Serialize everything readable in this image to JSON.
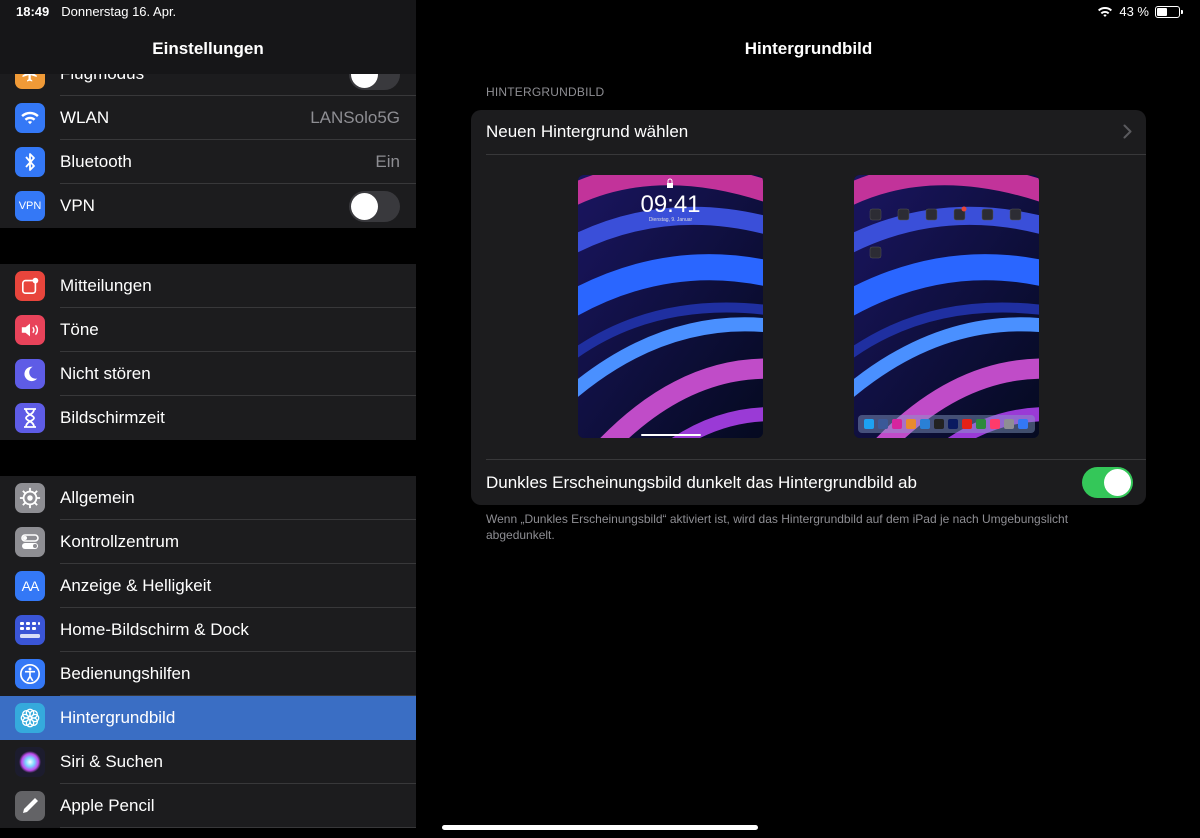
{
  "status": {
    "time": "18:49",
    "date": "Donnerstag 16. Apr.",
    "battery": "43 %",
    "battery_level": 0.43
  },
  "sidebar": {
    "title": "Einstellungen",
    "group1": [
      {
        "label": "Flugmodus",
        "icon": "airplane-icon",
        "color": "#f09a37",
        "toggle": false
      },
      {
        "label": "WLAN",
        "icon": "wifi-icon",
        "color": "#3478f6",
        "value": "LANSolo5G"
      },
      {
        "label": "Bluetooth",
        "icon": "bluetooth-icon",
        "color": "#3478f6",
        "value": "Ein"
      },
      {
        "label": "VPN",
        "icon": "vpn-icon",
        "color": "#3478f6",
        "toggle": false
      }
    ],
    "group2": [
      {
        "label": "Mitteilungen",
        "icon": "notifications-icon",
        "color": "#e8453c"
      },
      {
        "label": "Töne",
        "icon": "sounds-icon",
        "color": "#e8435a"
      },
      {
        "label": "Nicht stören",
        "icon": "moon-icon",
        "color": "#5e5ce6"
      },
      {
        "label": "Bildschirmzeit",
        "icon": "hourglass-icon",
        "color": "#5e5ce6"
      }
    ],
    "group3": [
      {
        "label": "Allgemein",
        "icon": "gear-icon",
        "color": "#8e8e93"
      },
      {
        "label": "Kontrollzentrum",
        "icon": "control-center-icon",
        "color": "#8e8e93"
      },
      {
        "label": "Anzeige & Helligkeit",
        "icon": "display-icon",
        "color": "#3478f6"
      },
      {
        "label": "Home-Bildschirm & Dock",
        "icon": "home-screen-icon",
        "color": "#3a55d6"
      },
      {
        "label": "Bedienungshilfen",
        "icon": "accessibility-icon",
        "color": "#3478f6"
      },
      {
        "label": "Hintergrundbild",
        "icon": "wallpaper-icon",
        "color": "#35aadc",
        "selected": true
      },
      {
        "label": "Siri & Suchen",
        "icon": "siri-icon",
        "color": "#222"
      },
      {
        "label": "Apple Pencil",
        "icon": "pencil-icon",
        "color": "#636366"
      }
    ]
  },
  "detail": {
    "title": "Hintergrundbild",
    "section_header": "HINTERGRUNDBILD",
    "choose_label": "Neuen Hintergrund wählen",
    "lock_preview": {
      "time": "09:41",
      "date": "Dienstag, 9. Januar"
    },
    "dark_label": "Dunkles Erscheinungsbild dunkelt das Hintergrundbild ab",
    "dark_toggle": true,
    "footer": "Wenn „Dunkles Erscheinungsbild“ aktiviert ist, wird das Hintergrundbild auf dem iPad je nach Umgebungslicht abgedunkelt."
  }
}
